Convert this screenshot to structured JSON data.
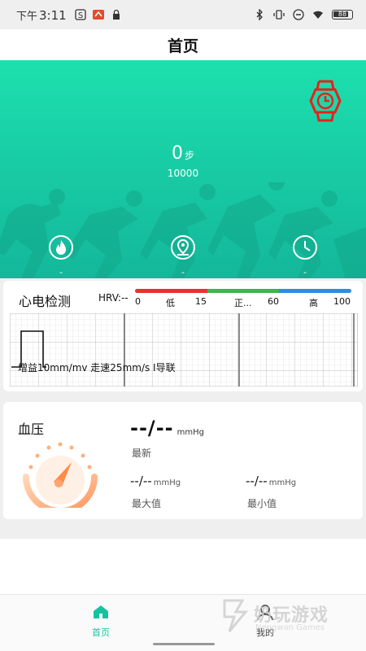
{
  "status_bar": {
    "time_prefix": "下午",
    "time": "3:11",
    "battery": "88"
  },
  "header": {
    "title": "首页"
  },
  "hero": {
    "steps_value": "0",
    "steps_unit": "步",
    "steps_goal": "10000",
    "stats": [
      {
        "icon": "flame-icon",
        "value": "-"
      },
      {
        "icon": "location-icon",
        "value": "-"
      },
      {
        "icon": "clock-icon",
        "value": "-"
      }
    ],
    "watch_icon_color": "#e8211d",
    "gradient_top": "#1de0ae",
    "gradient_bottom": "#14b79a"
  },
  "ecg": {
    "title": "心电检测",
    "hrv_label": "HRV:--",
    "ticks": [
      "0",
      "低",
      "15",
      "正...",
      "60",
      "高",
      "100"
    ],
    "bar_colors": [
      "#e8322a",
      "#3cb84a",
      "#2a8ee8"
    ],
    "info": "增益10mm/mv 走速25mm/s I导联"
  },
  "blood_pressure": {
    "title": "血压",
    "main_value": "--/--",
    "main_unit": "mmHg",
    "latest_label": "最新",
    "max_value": "--/--",
    "max_unit": "mmHg",
    "max_label": "最大值",
    "min_value": "--/--",
    "min_unit": "mmHg",
    "min_label": "最小值"
  },
  "bottom_nav": {
    "home_label": "首页",
    "mine_label": "我的",
    "active_color": "#16c3a1"
  },
  "watermark": {
    "text": "奶玩游戏",
    "sub": "Nengwan Games"
  }
}
